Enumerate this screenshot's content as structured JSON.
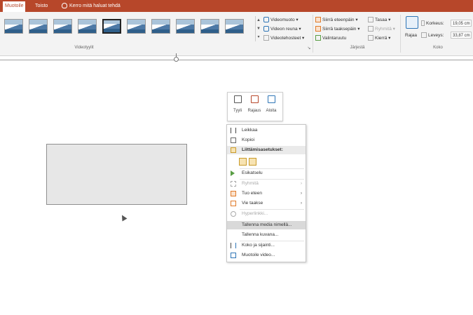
{
  "tabs": {
    "active": "Muotoile",
    "next": "Toisto",
    "tell_me": "Kerro mitä haluat tehdä"
  },
  "ribbon": {
    "video_styles_label": "Videotyylit",
    "video_shape": "Videomuoto",
    "video_border": "Videon reuna",
    "video_effects": "Videotehosteet",
    "bring_forward": "Siirrä eteenpäin",
    "send_backward": "Siirrä taaksepäin",
    "selection_pane": "Valintaruutu",
    "align": "Tasaa",
    "group": "Ryhmitä",
    "rotate": "Kierrä",
    "arrange_label": "Järjestä",
    "crop": "Rajaa",
    "height_label": "Korkeus:",
    "height_value": "19,05 cm",
    "width_label": "Leveys:",
    "width_value": "33,87 cm",
    "size_label": "Koko"
  },
  "mini_toolbar": {
    "style": "Tyyli",
    "crop": "Rajaus",
    "start": "Aloita"
  },
  "context_menu": {
    "cut": "Leikkaa",
    "copy": "Kopioi",
    "paste_options": "Liittämisasetukset:",
    "preview": "Esikatselu",
    "group": "Ryhmitä",
    "bring_to_front": "Tuo eteen",
    "send_to_back": "Vie taakse",
    "hyperlink": "Hyperlinkki...",
    "save_media_as": "Tallenna media nimellä...",
    "save_as_picture": "Tallenna kuvana...",
    "size_and_position": "Koko ja sijainti...",
    "format_video": "Muotoile video..."
  },
  "colors": {
    "accent": "#b7472a",
    "menu_hover": "#d9d9d9"
  }
}
